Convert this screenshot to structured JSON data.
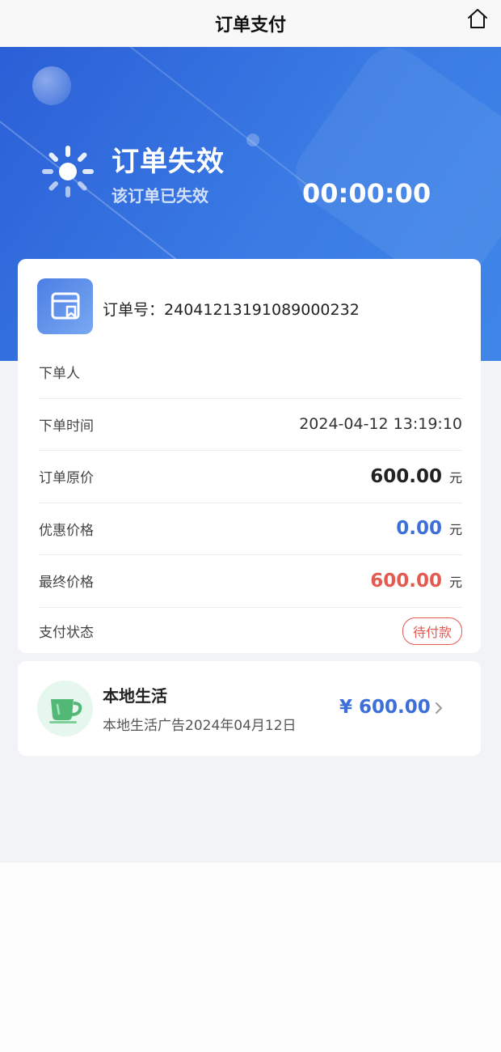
{
  "header": {
    "title": "订单支付",
    "home_icon": "home-icon"
  },
  "status": {
    "title": "订单失效",
    "subtitle": "该订单已失效",
    "countdown": "00:00:00",
    "icon": "loading-sun-icon"
  },
  "order": {
    "number_label": "订单号：",
    "number": "24041213191089000232",
    "icon": "order-card-icon",
    "rows": [
      {
        "label": "下单人",
        "value": ""
      },
      {
        "label": "下单时间",
        "value": "2024-04-12 13:19:10"
      },
      {
        "label": "订单原价",
        "value": "600.00",
        "unit": "元"
      },
      {
        "label": "优惠价格",
        "value": "0.00",
        "unit": "元"
      },
      {
        "label": "最终价格",
        "value": "600.00",
        "unit": "元"
      },
      {
        "label": "支付状态",
        "value": "待付款"
      }
    ]
  },
  "item": {
    "title": "本地生活",
    "subtitle": "本地生活广告2024年04月12日",
    "price": "¥ 600.00",
    "icon": "coffee-cup-icon"
  },
  "colors": {
    "accent": "#3d6fd8",
    "danger": "#e55a50",
    "hero_start": "#2b5fd7",
    "hero_end": "#3f86e8"
  }
}
